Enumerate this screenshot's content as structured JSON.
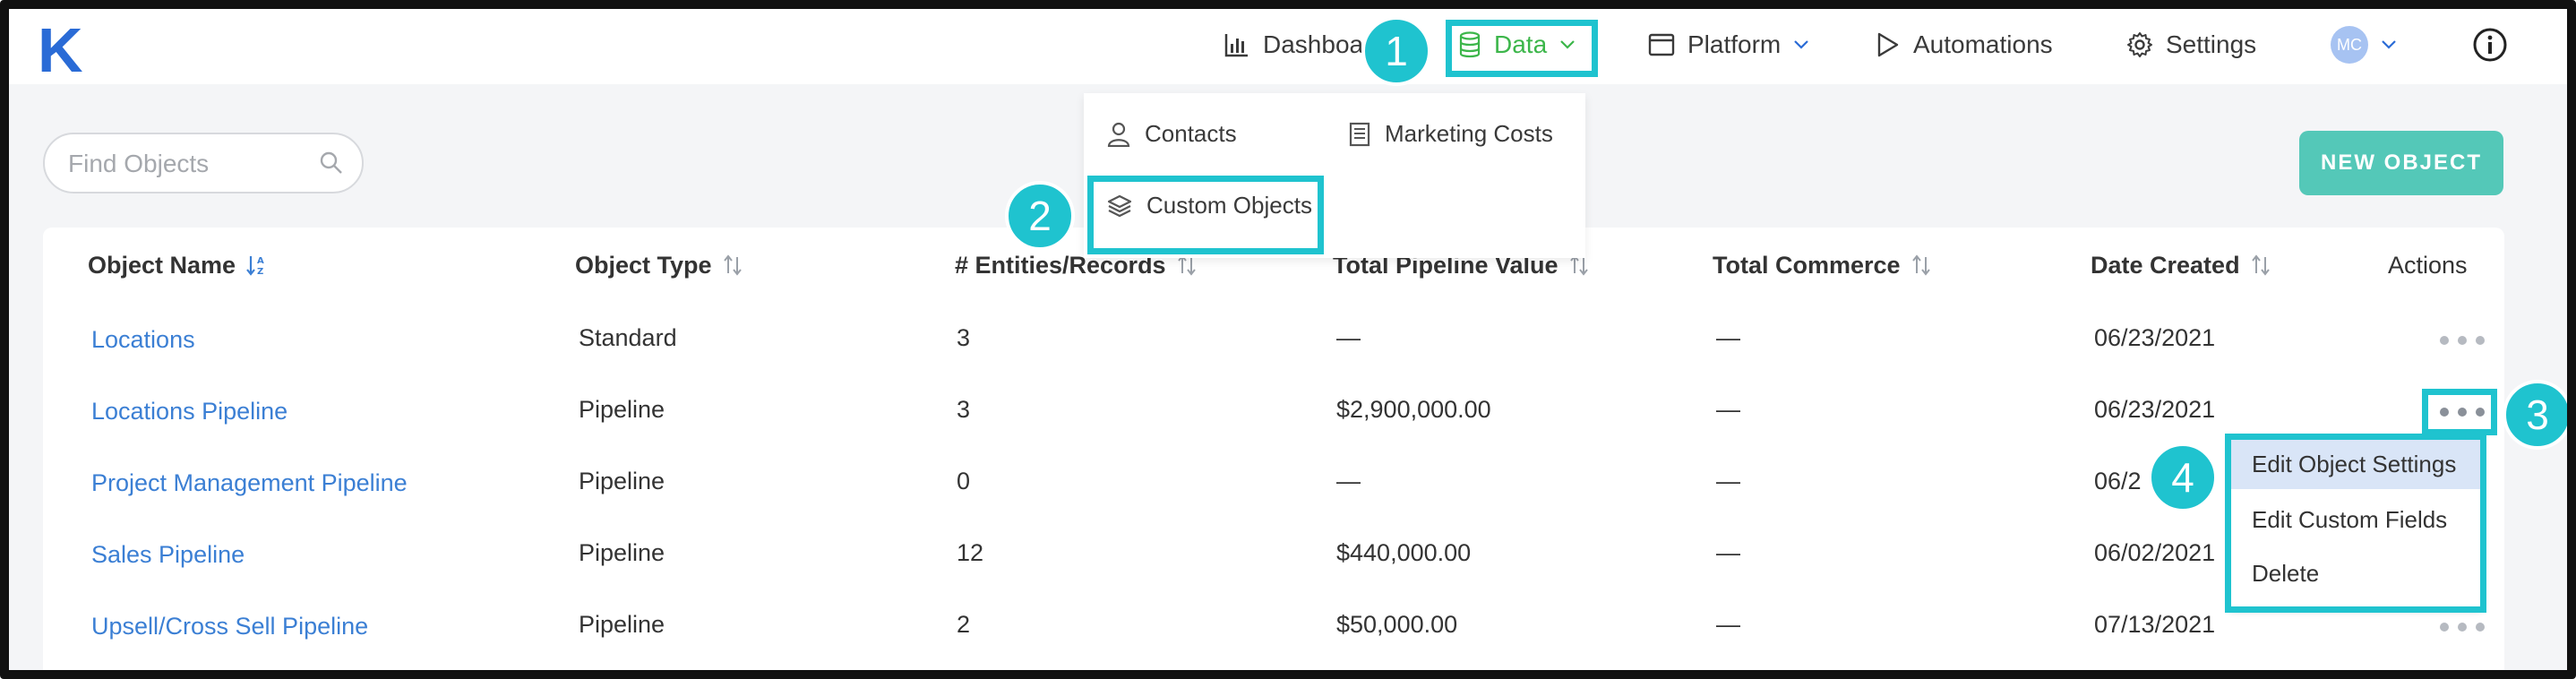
{
  "app": {
    "logo": "K"
  },
  "nav": {
    "dashboard": "Dashboard",
    "data": "Data",
    "platform": "Platform",
    "automations": "Automations",
    "settings": "Settings",
    "avatar_initials": "MC"
  },
  "data_menu": {
    "contacts": "Contacts",
    "marketing_costs": "Marketing Costs",
    "custom_objects": "Custom Objects"
  },
  "search": {
    "placeholder": "Find Objects"
  },
  "new_object_label": "NEW OBJECT",
  "table": {
    "headers": {
      "name": "Object Name",
      "type": "Object Type",
      "records": "# Entities/Records",
      "pipeline": "Total Pipeline Value",
      "commerce": "Total Commerce",
      "date": "Date Created",
      "actions": "Actions"
    },
    "rows": [
      {
        "name": "Locations",
        "type": "Standard",
        "records": "3",
        "pipeline": "—",
        "commerce": "—",
        "date": "06/23/2021"
      },
      {
        "name": "Locations Pipeline",
        "type": "Pipeline",
        "records": "3",
        "pipeline": "$2,900,000.00",
        "commerce": "—",
        "date": "06/23/2021"
      },
      {
        "name": "Project Management Pipeline",
        "type": "Pipeline",
        "records": "0",
        "pipeline": "—",
        "commerce": "—",
        "date": "06/2"
      },
      {
        "name": "Sales Pipeline",
        "type": "Pipeline",
        "records": "12",
        "pipeline": "$440,000.00",
        "commerce": "—",
        "date": "06/02/2021"
      },
      {
        "name": "Upsell/Cross Sell Pipeline",
        "type": "Pipeline",
        "records": "2",
        "pipeline": "$50,000.00",
        "commerce": "—",
        "date": "07/13/2021"
      }
    ]
  },
  "row_actions_menu": {
    "edit_settings": "Edit Object Settings",
    "edit_fields": "Edit Custom Fields",
    "delete": "Delete"
  },
  "callouts": {
    "one": "1",
    "two": "2",
    "three": "3",
    "four": "4"
  },
  "colors": {
    "brand": "#2a6bd6",
    "active_nav": "#3cb64a",
    "accent_button": "#54c8b8",
    "link": "#3b7fd4",
    "callout": "#1fc3cf"
  }
}
